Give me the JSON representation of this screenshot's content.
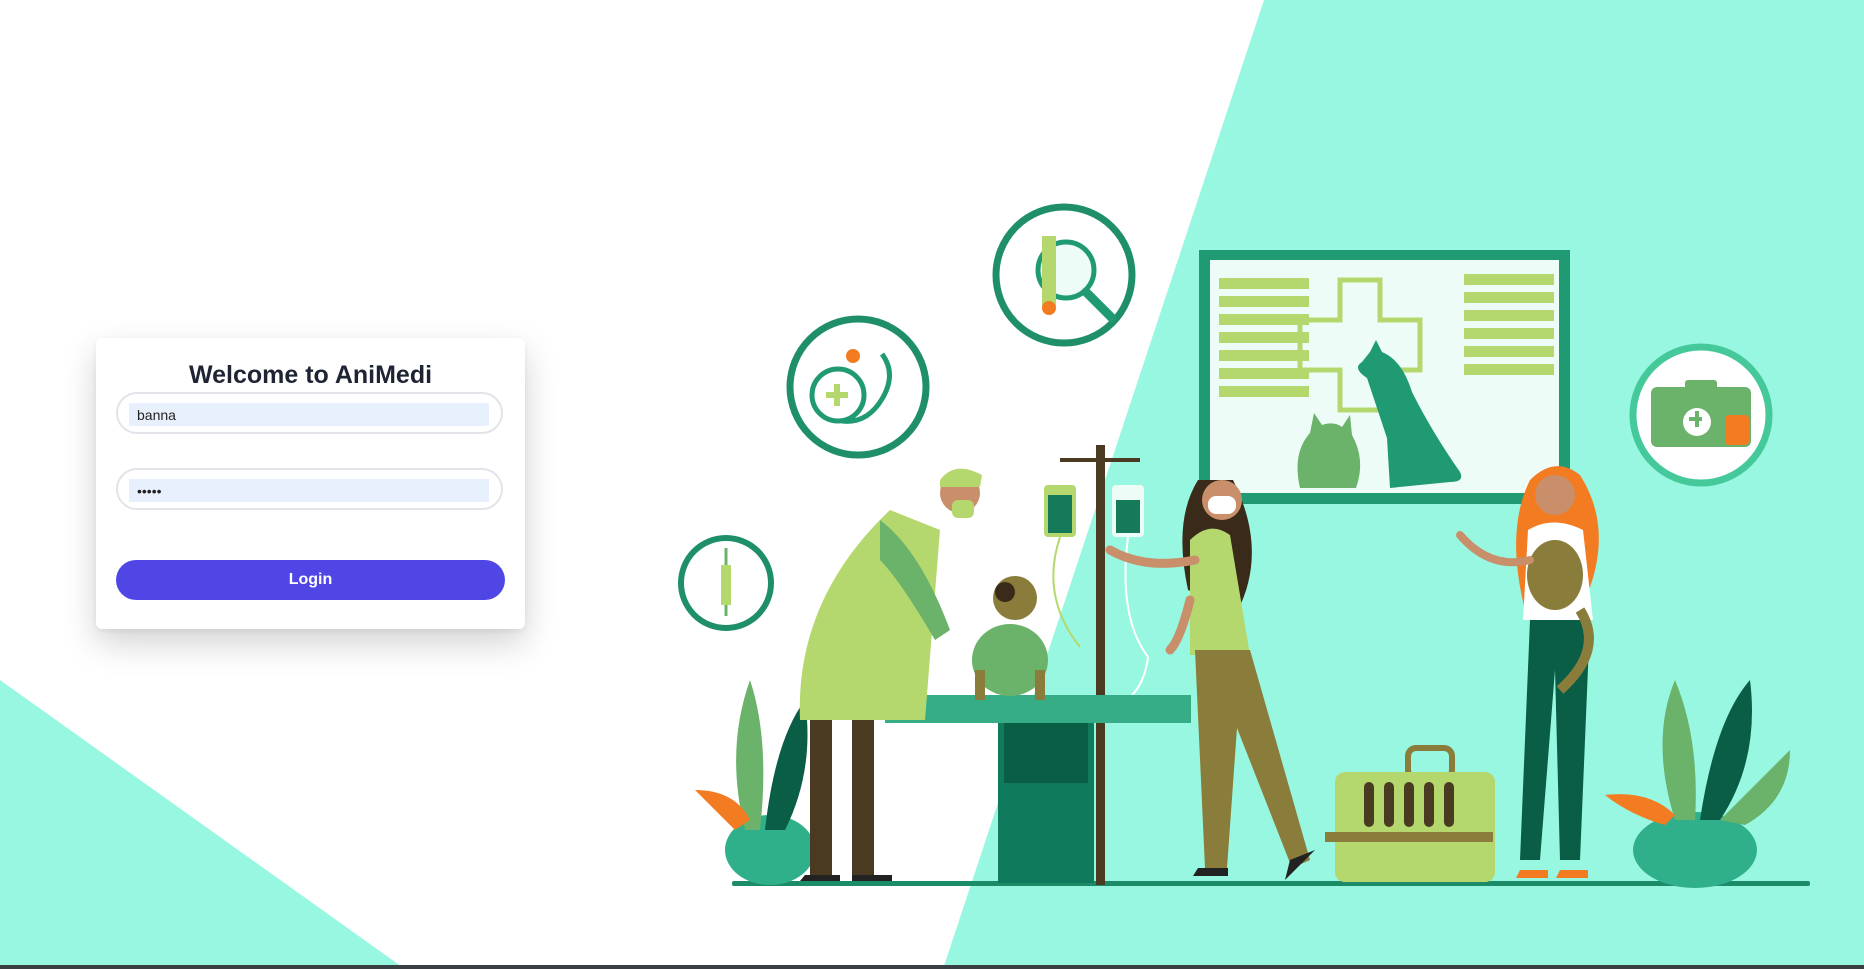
{
  "app": {
    "title": "Welcome to AniMedi"
  },
  "login": {
    "username_value": "banna",
    "password_value": "banna",
    "button_label": "Login"
  },
  "colors": {
    "accent": "#4f46e5",
    "mint": "#98f7e0",
    "dark_green": "#0f7a5c",
    "light_green": "#b5d86e"
  }
}
